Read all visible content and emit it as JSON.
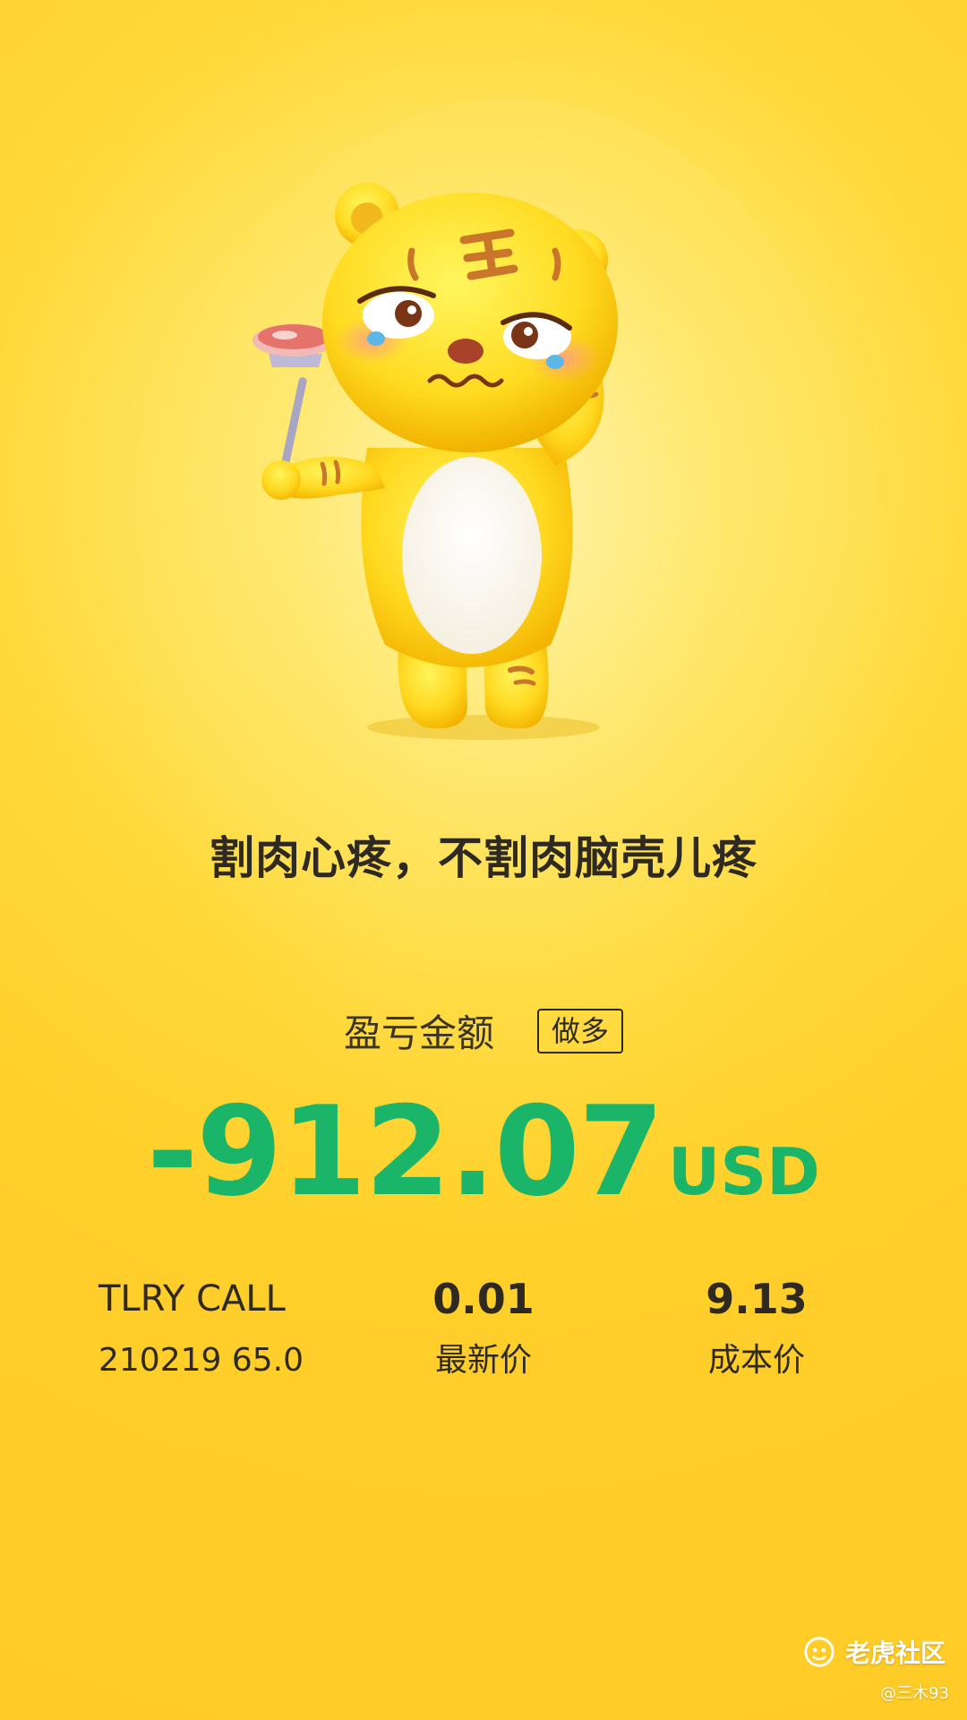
{
  "slogan": "割肉心疼，不割肉脑壳儿疼",
  "pnl": {
    "label": "盈亏金额",
    "direction": "做多",
    "amount": "-912.07",
    "currency": "USD",
    "color": "#1bb56a"
  },
  "position": {
    "symbol": "TLRY CALL",
    "contract": "210219 65.0",
    "last_price": "0.01",
    "last_price_label": "最新价",
    "cost_price": "9.13",
    "cost_price_label": "成本价"
  },
  "watermark": {
    "community": "老虎社区",
    "user": "@三木93"
  },
  "colors": {
    "background": "#ffd23a",
    "text": "#2e2a22"
  }
}
